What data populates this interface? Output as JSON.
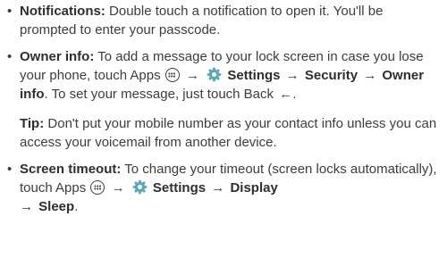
{
  "items": [
    {
      "title": "Notifications:",
      "text": "Double touch a notification to open it. You'll be prompted to enter your passcode."
    },
    {
      "title": "Owner info:",
      "text_1": "To add a message to your lock screen in case you lose your phone, touch Apps",
      "settings": "Settings",
      "security": "Security",
      "owner_info": "Owner info",
      "text_2": ". To set your message, just touch Back"
    },
    {
      "title": "Screen timeout:",
      "text_1": "To change your timeout (screen locks automatically), touch Apps",
      "settings": "Settings",
      "display": "Display",
      "sleep": "Sleep"
    }
  ],
  "tip": {
    "title": "Tip:",
    "text": "Don't put your mobile number as your contact info unless you can access your voicemail from another device."
  },
  "symbols": {
    "bullet": "•",
    "arrow": "→",
    "back": "←",
    "period": "."
  },
  "icons": [
    "apps-icon",
    "settings-gear-icon",
    "back-arrow-icon"
  ],
  "colors": {
    "text": "#3c3c3c",
    "gear": "#5aa8b8"
  }
}
